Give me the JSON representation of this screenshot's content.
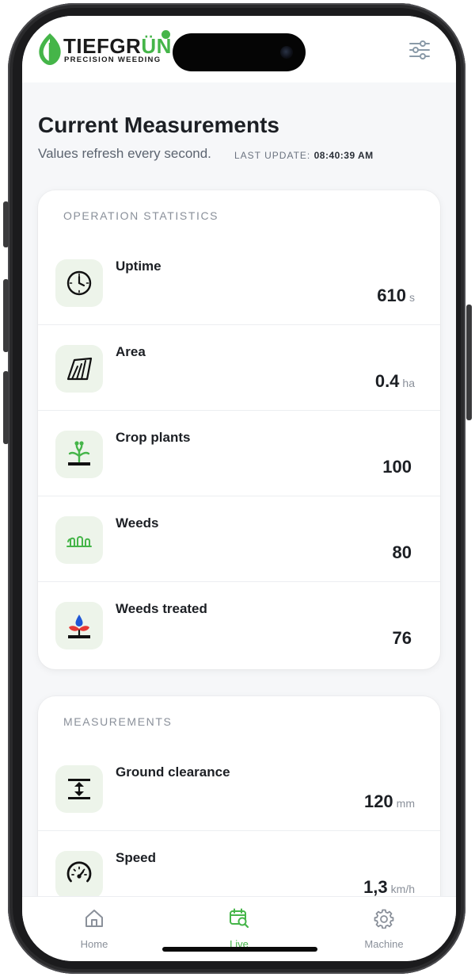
{
  "brand": {
    "name_part1": "TIEFGR",
    "name_part2": "ÜN",
    "tagline": "PRECISION WEEDING",
    "accent_color": "#45b549"
  },
  "header": {
    "menu_icon": "sliders-icon"
  },
  "page": {
    "title": "Current Measurements",
    "subtitle": "Values refresh every second.",
    "last_update_label": "LAST UPDATE:",
    "last_update_time": "08:40:39 AM"
  },
  "operation_statistics": {
    "heading": "OPERATION STATISTICS",
    "items": [
      {
        "label": "Uptime",
        "value": "610",
        "unit": "s",
        "icon": "clock-icon"
      },
      {
        "label": "Area",
        "value": "0.4",
        "unit": "ha",
        "icon": "field-area-icon"
      },
      {
        "label": "Crop plants",
        "value": "100",
        "unit": "",
        "icon": "crop-plant-icon"
      },
      {
        "label": "Weeds",
        "value": "80",
        "unit": "",
        "icon": "weeds-icon"
      },
      {
        "label": "Weeds treated",
        "value": "76",
        "unit": "",
        "icon": "weed-treatment-icon"
      }
    ]
  },
  "measurements": {
    "heading": "MEASUREMENTS",
    "items": [
      {
        "label": "Ground clearance",
        "value": "120",
        "unit": "mm",
        "icon": "ground-clearance-icon"
      },
      {
        "label": "Speed",
        "value": "1,3",
        "unit": "km/h",
        "icon": "speedometer-icon"
      }
    ]
  },
  "tabs": [
    {
      "label": "Home",
      "icon": "home-icon",
      "active": false
    },
    {
      "label": "Live",
      "icon": "live-calendar-icon",
      "active": true
    },
    {
      "label": "Machine",
      "icon": "gear-icon",
      "active": false
    }
  ]
}
